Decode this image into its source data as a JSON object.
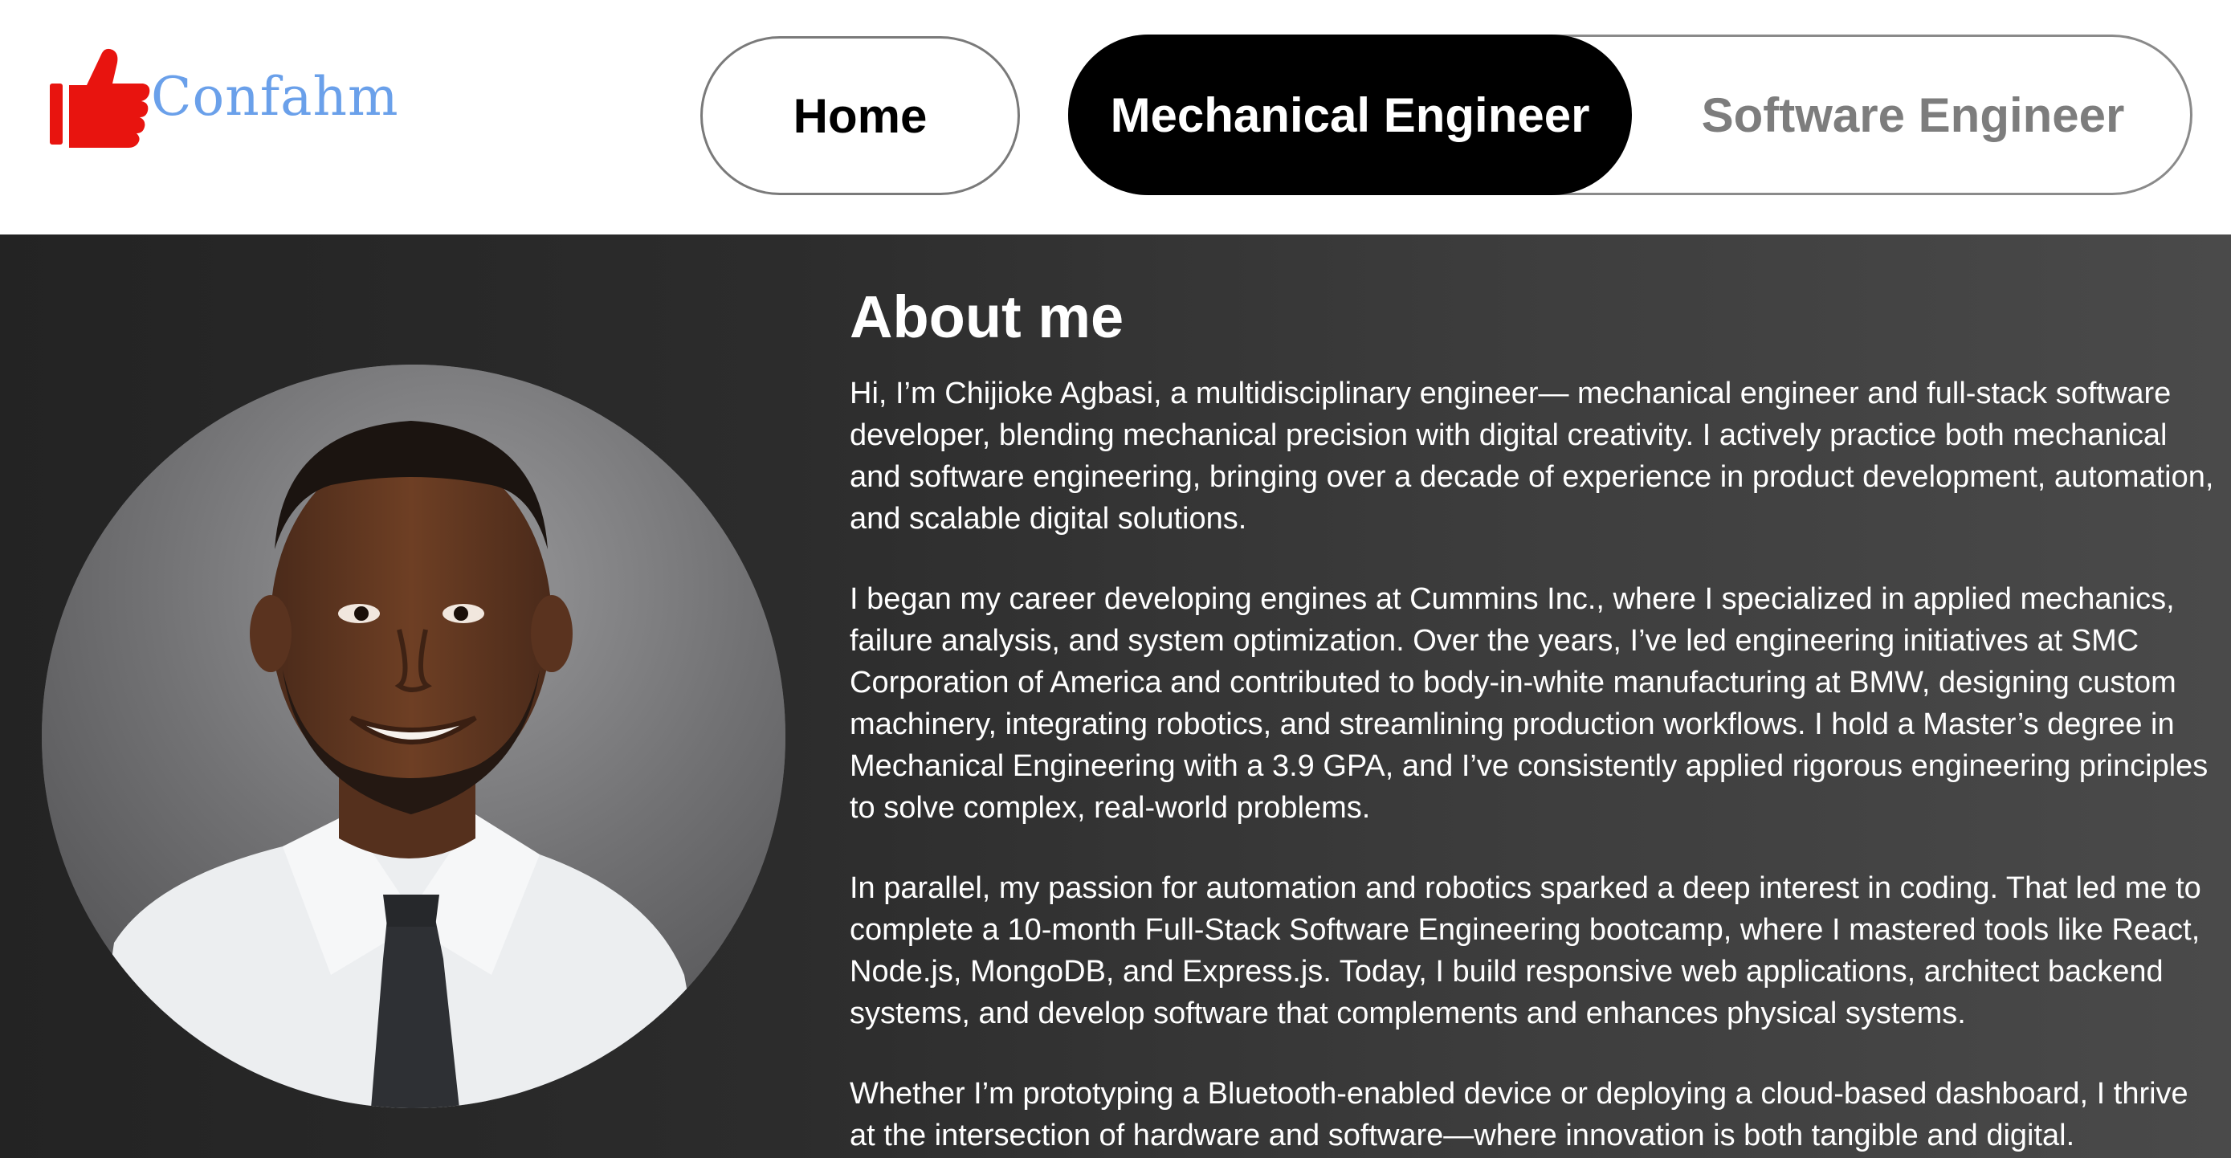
{
  "logo": {
    "text": "Confahm",
    "icon": "thumbs-up-icon",
    "icon_color": "#e8140f",
    "text_color": "#6aa0ea"
  },
  "nav": {
    "home_label": "Home",
    "mechanical_label": "Mechanical Engineer",
    "software_label": "Software Engineer",
    "active": "Mechanical Engineer"
  },
  "about": {
    "title": "About me",
    "paragraphs": [
      "Hi, I’m Chijioke Agbasi, a multidisciplinary engineer— mechanical engineer and full-stack software developer, blending mechanical precision with digital creativity. I actively practice both mechanical and software engineering, bringing over a decade of experience in product development, automation, and scalable digital solutions.",
      "I began my career developing engines at Cummins Inc., where I specialized in applied mechanics, failure analysis, and system optimization. Over the years, I’ve led engineering initiatives at SMC Corporation of America and contributed to body-in-white manufacturing at BMW, designing custom machinery, integrating robotics, and streamlining production workflows. I hold a Master’s degree in Mechanical Engineering with a 3.9 GPA, and I’ve consistently applied rigorous engineering principles to solve complex, real-world problems.",
      "In parallel, my passion for automation and robotics sparked a deep interest in coding. That led me to complete a 10-month Full-Stack Software Engineering bootcamp, where I mastered tools like React, Node.js, MongoDB, and Express.js. Today, I build responsive web applications, architect backend systems, and develop software that complements and enhances physical systems.",
      "Whether I’m prototyping a Bluetooth-enabled device or deploying a cloud-based dashboard, I thrive at the intersection of hardware and software—where innovation is both tangible and digital."
    ]
  },
  "colors": {
    "nav_active_bg": "#000000",
    "nav_active_text": "#ffffff",
    "nav_inactive_text": "#7d7d7d",
    "section_bg_left": "#232323",
    "section_bg_right": "#4a4a4a"
  }
}
